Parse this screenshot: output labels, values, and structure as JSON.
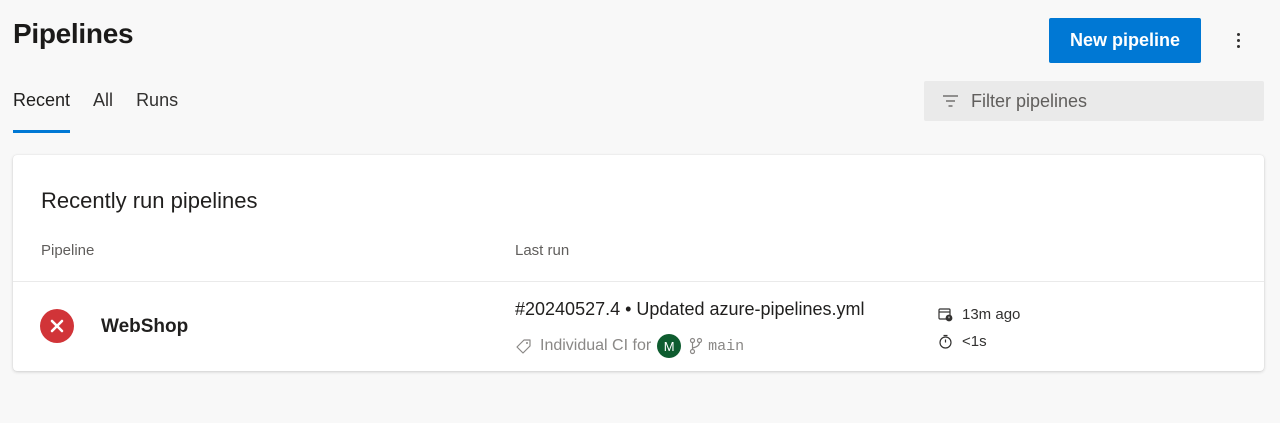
{
  "header": {
    "title": "Pipelines",
    "new_button_label": "New pipeline",
    "accent_color": "#0078d4"
  },
  "tabs": [
    {
      "label": "Recent",
      "active": true
    },
    {
      "label": "All",
      "active": false
    },
    {
      "label": "Runs",
      "active": false
    }
  ],
  "filter": {
    "placeholder": "Filter pipelines",
    "icon": "filter-icon"
  },
  "card": {
    "title": "Recently run pipelines",
    "columns": {
      "pipeline": "Pipeline",
      "last_run": "Last run"
    }
  },
  "pipelines": [
    {
      "name": "WebShop",
      "status": "failed",
      "status_color": "#d13438",
      "run_title": "#20240527.4 • Updated azure-pipelines.yml",
      "trigger": "Individual CI for",
      "avatar_initial": "M",
      "branch": "main",
      "time_ago": "13m ago",
      "duration": "<1s"
    }
  ]
}
